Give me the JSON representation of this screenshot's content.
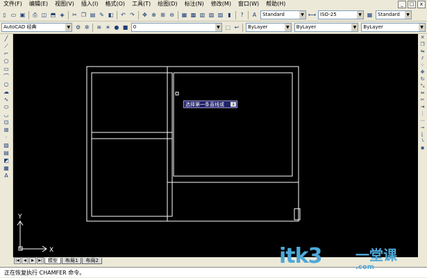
{
  "menu": {
    "items": [
      {
        "label": "文件(F)"
      },
      {
        "label": "编辑(E)"
      },
      {
        "label": "视图(V)"
      },
      {
        "label": "插入(I)"
      },
      {
        "label": "格式(O)"
      },
      {
        "label": "工具(T)"
      },
      {
        "label": "绘图(D)"
      },
      {
        "label": "标注(N)"
      },
      {
        "label": "修改(M)"
      },
      {
        "label": "窗口(W)"
      },
      {
        "label": "帮助(H)"
      }
    ],
    "win_controls": [
      "_",
      "□",
      "x"
    ]
  },
  "toolbar1": {
    "text_style": "Standard",
    "dim_style": "ISO-25",
    "table_style": "Standard"
  },
  "toolbar2": {
    "workspace": "AutoCAD 经典",
    "layer": "0",
    "color": "ByLayer",
    "linetype": "ByLayer",
    "lineweight": "ByLayer"
  },
  "prompt": {
    "text": "选择第一条直线或"
  },
  "ucs": {
    "x_label": "X",
    "y_label": "Y"
  },
  "tabs": [
    {
      "label": "模型",
      "active": true
    },
    {
      "label": "布局1",
      "active": false
    },
    {
      "label": "布局2",
      "active": false
    }
  ],
  "command_line": {
    "text": "正在恢复执行 CHAMFER 命令。"
  },
  "watermark": {
    "text": "itk3",
    "cn": "一堂课",
    "sub": ".com",
    "color": "#4ea8d8"
  },
  "colors": {
    "canvas": "#000000",
    "geometry": "#ffffff",
    "ui": "#ece9d8",
    "tooltip": "#22226a"
  }
}
